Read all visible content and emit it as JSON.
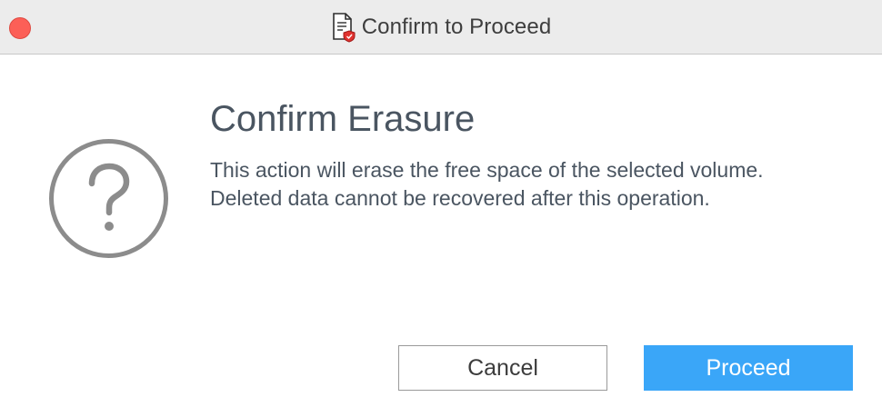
{
  "window": {
    "title": "Confirm to Proceed",
    "title_icon": "document-shield-icon",
    "close_button_color": "#fc5f57"
  },
  "dialog": {
    "icon": "question-circle-icon",
    "heading": "Confirm Erasure",
    "message_lines": [
      "This action will erase the free space of the selected volume.",
      "Deleted data cannot be recovered after this operation."
    ]
  },
  "buttons": {
    "cancel_label": "Cancel",
    "proceed_label": "Proceed",
    "proceed_color": "#3aa6f8"
  }
}
